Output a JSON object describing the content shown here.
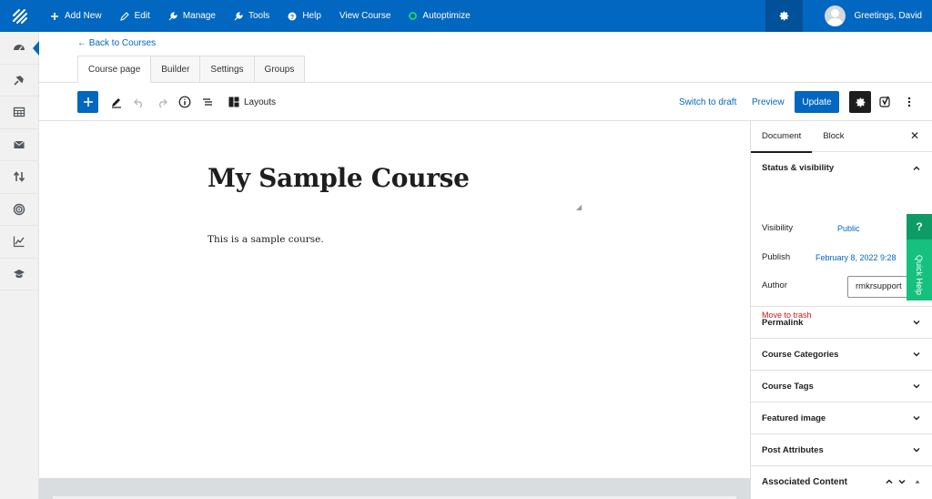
{
  "topbar": {
    "items": [
      {
        "label": "Add New",
        "icon": "plus-icon"
      },
      {
        "label": "Edit",
        "icon": "pencil-icon"
      },
      {
        "label": "Manage",
        "icon": "wrench-icon"
      },
      {
        "label": "Tools",
        "icon": "tools-icon"
      },
      {
        "label": "Help",
        "icon": "help-icon"
      },
      {
        "label": "View Course",
        "icon": ""
      },
      {
        "label": "Autoptimize",
        "icon": "status-dot-icon"
      }
    ],
    "greeting": "Greetings, David",
    "accent_color": "#0267c0"
  },
  "sidebar": {
    "items": [
      "dashboard-icon",
      "pin-icon",
      "table-icon",
      "mail-icon",
      "sort-icon",
      "target-icon",
      "chart-icon",
      "graduation-cap-icon"
    ]
  },
  "nav": {
    "back_link": "← Back to Courses",
    "tabs": [
      "Course page",
      "Builder",
      "Settings",
      "Groups"
    ]
  },
  "toolbar": {
    "layouts_label": "Layouts",
    "switch_to_draft": "Switch to draft",
    "preview": "Preview",
    "update": "Update"
  },
  "post": {
    "title": "My Sample Course",
    "body": "This is a sample course."
  },
  "panel": {
    "tabs": [
      "Document",
      "Block"
    ],
    "status_heading": "Status & visibility",
    "visibility_label": "Visibility",
    "visibility_value": "Public",
    "publish_label": "Publish",
    "publish_value": "February 8, 2022 9:28",
    "author_label": "Author",
    "author_value": "rmkrsupport",
    "trash_label": "Move to trash",
    "sections": [
      "Permalink",
      "Course Categories",
      "Course Tags",
      "Featured image",
      "Post Attributes"
    ],
    "associated_content": "Associated Content"
  },
  "quick_help": {
    "icon_label": "?",
    "label": "Quick Help"
  }
}
